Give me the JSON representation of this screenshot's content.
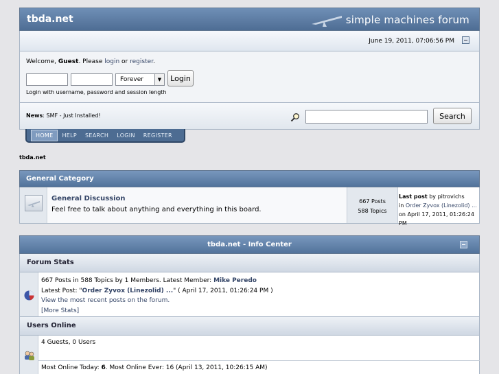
{
  "header": {
    "site_title": "tbda.net",
    "forum_brand": "simple machines forum",
    "datetime": "June 19, 2011, 07:06:56 PM"
  },
  "userbox": {
    "welcome_prefix": "Welcome, ",
    "guest": "Guest",
    "please": ". Please ",
    "login_link": "login",
    "or": " or ",
    "register_link": "register",
    "period": ".",
    "session_length": "Forever",
    "login_button": "Login",
    "hint": "Login with username, password and session length"
  },
  "news": {
    "label": "News",
    "text": ": SMF - Just Installed!",
    "search_button": "Search"
  },
  "menu": [
    {
      "label": "HOME"
    },
    {
      "label": "HELP"
    },
    {
      "label": "SEARCH"
    },
    {
      "label": "LOGIN"
    },
    {
      "label": "REGISTER"
    }
  ],
  "breadcrumb": "tbda.net",
  "category": {
    "title": "General Category",
    "board": {
      "name": "General Discussion",
      "description": "Feel free to talk about anything and everything in this board.",
      "posts": "667 Posts",
      "topics": "588 Topics",
      "last_post_label": "Last post",
      "last_post_by": " by pitrovichs",
      "in": "in ",
      "last_topic": "Order Zyvox (Linezolid) ...",
      "on": "on April 17, 2011, 01:26:24 PM"
    }
  },
  "info_center": {
    "title": "tbda.net - Info Center",
    "forum_stats": {
      "heading": "Forum Stats",
      "line1": "667 Posts in 588 Topics by 1 Members. Latest Member: ",
      "latest_member": "Mike Peredo",
      "latest_post_prefix": "Latest Post: \"",
      "latest_post": "Order Zyvox (Linezolid) ...",
      "latest_post_suffix": "\" ( April 17, 2011, 01:26:24 PM )",
      "recent_link": "View the most recent posts on the forum.",
      "more_stats": "[More Stats]"
    },
    "users_online": {
      "heading": "Users Online",
      "counts": "4 Guests, 0 Users",
      "most_prefix": "Most Online Today: ",
      "most_today": "6",
      "most_suffix": ". Most Online Ever: 16 (April 13, 2011, 10:26:15 AM)"
    }
  },
  "colors": {
    "header_blue": "#52739b",
    "link": "#334466"
  }
}
